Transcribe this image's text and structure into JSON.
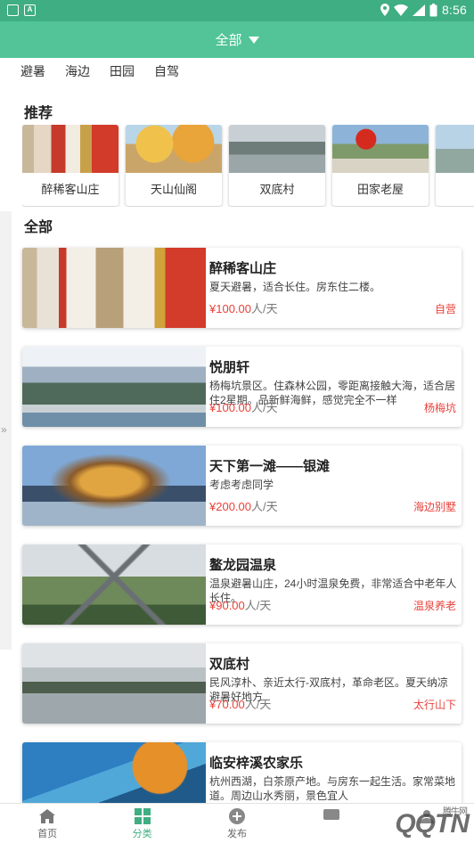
{
  "status_bar": {
    "time": "8:56"
  },
  "header": {
    "title": "全部"
  },
  "categories": [
    "避暑",
    "海边",
    "田园",
    "自驾"
  ],
  "recommend": {
    "title": "推荐",
    "items": [
      {
        "name": "醉稀客山庄"
      },
      {
        "name": "天山仙阁"
      },
      {
        "name": "双底村"
      },
      {
        "name": "田家老屋"
      }
    ]
  },
  "all": {
    "title": "全部",
    "items": [
      {
        "title": "醉稀客山庄",
        "desc": "夏天避暑，适合长住。房东住二楼。",
        "price": "¥100.00",
        "unit": "人/天",
        "tag": "自营"
      },
      {
        "title": "悦朋轩",
        "desc": "杨梅坑景区。住森林公园，零距离接触大海，适合居住2星期。品新鲜海鲜，感觉完全不一样",
        "price": "¥100.00",
        "unit": "人/天",
        "tag": "杨梅坑"
      },
      {
        "title": "天下第一滩——银滩",
        "desc": "考虑考虑同学",
        "price": "¥200.00",
        "unit": "人/天",
        "tag": "海边别墅"
      },
      {
        "title": "鳌龙园温泉",
        "desc": "温泉避暑山庄，24小时温泉免费，非常适合中老年人长住。",
        "price": "¥90.00",
        "unit": "人/天",
        "tag": "温泉养老"
      },
      {
        "title": "双底村",
        "desc": "民风淳朴、亲近太行-双底村，革命老区。夏天纳凉避暑好地方",
        "price": "¥70.00",
        "unit": "人/天",
        "tag": "太行山下"
      },
      {
        "title": "临安梓溪农家乐",
        "desc": "杭州西湖，白茶原产地。与房东一起生活。家常菜地道。周边山水秀丽，景色宜人",
        "price": "",
        "unit": "",
        "tag": ""
      }
    ]
  },
  "bottom_nav": {
    "home": "首页",
    "category": "分类",
    "publish": "发布"
  },
  "watermark": {
    "brand": "腾牛网",
    "logo": "QQTN"
  }
}
